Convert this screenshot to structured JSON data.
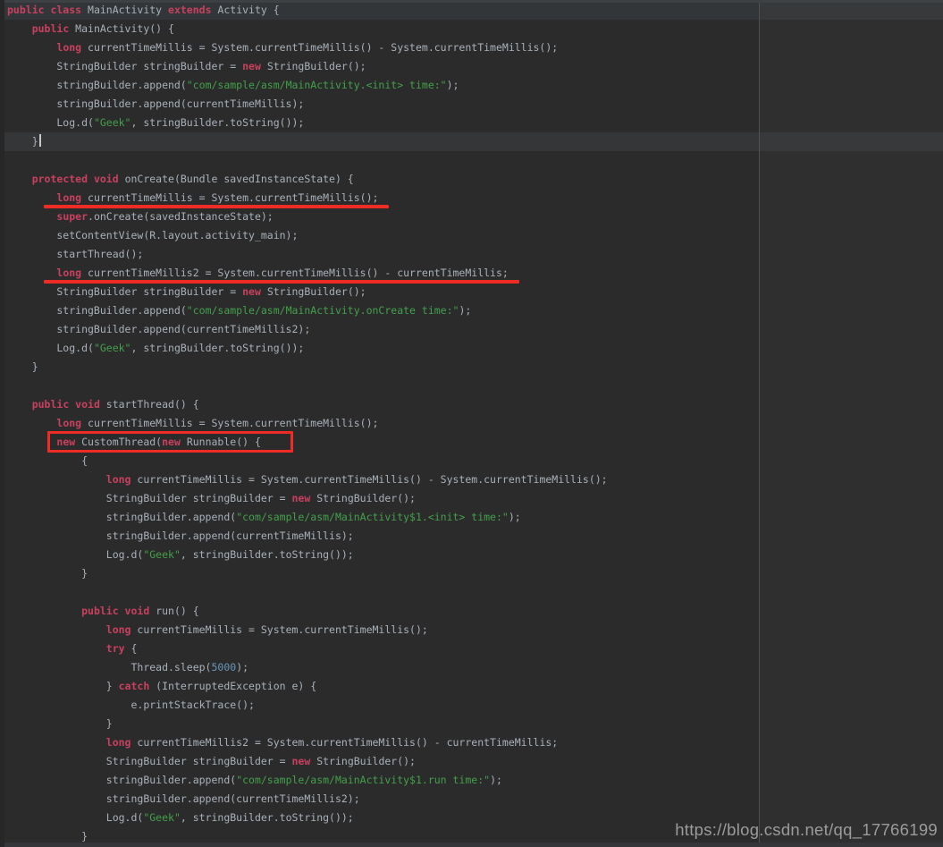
{
  "editor": {
    "colors": {
      "background": "#2b2b2b",
      "keyword": "#c8415f",
      "plain": "#a8b1ba",
      "string": "#43a04b",
      "number": "#6897bb",
      "annotation_red": "#ee2b24",
      "caret_line_background": "#343638",
      "margin_guide": "#4e5052"
    },
    "lines": [
      {
        "seg": [
          [
            "k",
            "public class "
          ],
          [
            "p",
            "MainActivity "
          ],
          [
            "k",
            "extends "
          ],
          [
            "p",
            "Activity {"
          ]
        ],
        "hl": "header"
      },
      {
        "seg": [
          [
            "p",
            "    "
          ],
          [
            "k",
            "public "
          ],
          [
            "p",
            "MainActivity() {"
          ]
        ]
      },
      {
        "seg": [
          [
            "p",
            "        "
          ],
          [
            "k",
            "long "
          ],
          [
            "p",
            "currentTimeMillis = System.currentTimeMillis() - System.currentTimeMillis();"
          ]
        ]
      },
      {
        "seg": [
          [
            "p",
            "        StringBuilder stringBuilder = "
          ],
          [
            "k",
            "new "
          ],
          [
            "p",
            "StringBuilder();"
          ]
        ]
      },
      {
        "seg": [
          [
            "p",
            "        stringBuilder.append("
          ],
          [
            "s",
            "\"com/sample/asm/MainActivity.<init> time:\""
          ],
          [
            "p",
            ");"
          ]
        ]
      },
      {
        "seg": [
          [
            "p",
            "        stringBuilder.append(currentTimeMillis);"
          ]
        ]
      },
      {
        "seg": [
          [
            "p",
            "        Log.d("
          ],
          [
            "s",
            "\"Geek\""
          ],
          [
            "p",
            ", stringBuilder.toString());"
          ]
        ]
      },
      {
        "seg": [
          [
            "p",
            "    }"
          ]
        ],
        "hl": "caret",
        "caret": true
      },
      {
        "seg": []
      },
      {
        "seg": [
          [
            "p",
            "    "
          ],
          [
            "k",
            "protected void "
          ],
          [
            "p",
            "onCreate(Bundle savedInstanceState) {"
          ]
        ]
      },
      {
        "seg": [
          [
            "p",
            "        "
          ],
          [
            "k",
            "long "
          ],
          [
            "p",
            "currentTimeMillis = System.currentTimeMillis();"
          ]
        ],
        "a": "u"
      },
      {
        "seg": [
          [
            "p",
            "        "
          ],
          [
            "k",
            "super"
          ],
          [
            "p",
            ".onCreate(savedInstanceState);"
          ]
        ]
      },
      {
        "seg": [
          [
            "p",
            "        setContentView(R.layout.activity_main);"
          ]
        ]
      },
      {
        "seg": [
          [
            "p",
            "        startThread();"
          ]
        ]
      },
      {
        "seg": [
          [
            "p",
            "        "
          ],
          [
            "k",
            "long "
          ],
          [
            "p",
            "currentTimeMillis2 = System.currentTimeMillis() - currentTimeMillis;"
          ]
        ],
        "a": "u"
      },
      {
        "seg": [
          [
            "p",
            "        StringBuilder stringBuilder = "
          ],
          [
            "k",
            "new "
          ],
          [
            "p",
            "StringBuilder();"
          ]
        ]
      },
      {
        "seg": [
          [
            "p",
            "        stringBuilder.append("
          ],
          [
            "s",
            "\"com/sample/asm/MainActivity.onCreate time:\""
          ],
          [
            "p",
            ");"
          ]
        ]
      },
      {
        "seg": [
          [
            "p",
            "        stringBuilder.append(currentTimeMillis2);"
          ]
        ]
      },
      {
        "seg": [
          [
            "p",
            "        Log.d("
          ],
          [
            "s",
            "\"Geek\""
          ],
          [
            "p",
            ", stringBuilder.toString());"
          ]
        ]
      },
      {
        "seg": [
          [
            "p",
            "    }"
          ]
        ]
      },
      {
        "seg": []
      },
      {
        "seg": [
          [
            "p",
            "    "
          ],
          [
            "k",
            "public void "
          ],
          [
            "p",
            "startThread() {"
          ]
        ]
      },
      {
        "seg": [
          [
            "p",
            "        "
          ],
          [
            "k",
            "long "
          ],
          [
            "p",
            "currentTimeMillis = System.currentTimeMillis();"
          ]
        ]
      },
      {
        "seg": [
          [
            "p",
            "        "
          ],
          [
            "k",
            "new "
          ],
          [
            "p",
            "CustomThread("
          ],
          [
            "k",
            "new "
          ],
          [
            "p",
            "Runnable() {"
          ]
        ],
        "a": "b"
      },
      {
        "seg": [
          [
            "p",
            "            {"
          ]
        ]
      },
      {
        "seg": [
          [
            "p",
            "                "
          ],
          [
            "k",
            "long "
          ],
          [
            "p",
            "currentTimeMillis = System.currentTimeMillis() - System.currentTimeMillis();"
          ]
        ]
      },
      {
        "seg": [
          [
            "p",
            "                StringBuilder stringBuilder = "
          ],
          [
            "k",
            "new "
          ],
          [
            "p",
            "StringBuilder();"
          ]
        ]
      },
      {
        "seg": [
          [
            "p",
            "                stringBuilder.append("
          ],
          [
            "s",
            "\"com/sample/asm/MainActivity$1.<init> time:\""
          ],
          [
            "p",
            ");"
          ]
        ]
      },
      {
        "seg": [
          [
            "p",
            "                stringBuilder.append(currentTimeMillis);"
          ]
        ]
      },
      {
        "seg": [
          [
            "p",
            "                Log.d("
          ],
          [
            "s",
            "\"Geek\""
          ],
          [
            "p",
            ", stringBuilder.toString());"
          ]
        ]
      },
      {
        "seg": [
          [
            "p",
            "            }"
          ]
        ]
      },
      {
        "seg": []
      },
      {
        "seg": [
          [
            "p",
            "            "
          ],
          [
            "k",
            "public void "
          ],
          [
            "p",
            "run() {"
          ]
        ]
      },
      {
        "seg": [
          [
            "p",
            "                "
          ],
          [
            "k",
            "long "
          ],
          [
            "p",
            "currentTimeMillis = System.currentTimeMillis();"
          ]
        ]
      },
      {
        "seg": [
          [
            "p",
            "                "
          ],
          [
            "k",
            "try "
          ],
          [
            "p",
            "{"
          ]
        ]
      },
      {
        "seg": [
          [
            "p",
            "                    Thread.sleep("
          ],
          [
            "n",
            "5000"
          ],
          [
            "p",
            ");"
          ]
        ]
      },
      {
        "seg": [
          [
            "p",
            "                } "
          ],
          [
            "k",
            "catch "
          ],
          [
            "p",
            "(InterruptedException e) {"
          ]
        ]
      },
      {
        "seg": [
          [
            "p",
            "                    e.printStackTrace();"
          ]
        ]
      },
      {
        "seg": [
          [
            "p",
            "                }"
          ]
        ]
      },
      {
        "seg": [
          [
            "p",
            "                "
          ],
          [
            "k",
            "long "
          ],
          [
            "p",
            "currentTimeMillis2 = System.currentTimeMillis() - currentTimeMillis;"
          ]
        ]
      },
      {
        "seg": [
          [
            "p",
            "                StringBuilder stringBuilder = "
          ],
          [
            "k",
            "new "
          ],
          [
            "p",
            "StringBuilder();"
          ]
        ]
      },
      {
        "seg": [
          [
            "p",
            "                stringBuilder.append("
          ],
          [
            "s",
            "\"com/sample/asm/MainActivity$1.run time:\""
          ],
          [
            "p",
            ");"
          ]
        ]
      },
      {
        "seg": [
          [
            "p",
            "                stringBuilder.append(currentTimeMillis2);"
          ]
        ]
      },
      {
        "seg": [
          [
            "p",
            "                Log.d("
          ],
          [
            "s",
            "\"Geek\""
          ],
          [
            "p",
            ", stringBuilder.toString());"
          ]
        ]
      },
      {
        "seg": [
          [
            "p",
            "            }"
          ]
        ]
      }
    ]
  },
  "watermark": {
    "text": "https://blog.csdn.net/qq_17766199"
  }
}
